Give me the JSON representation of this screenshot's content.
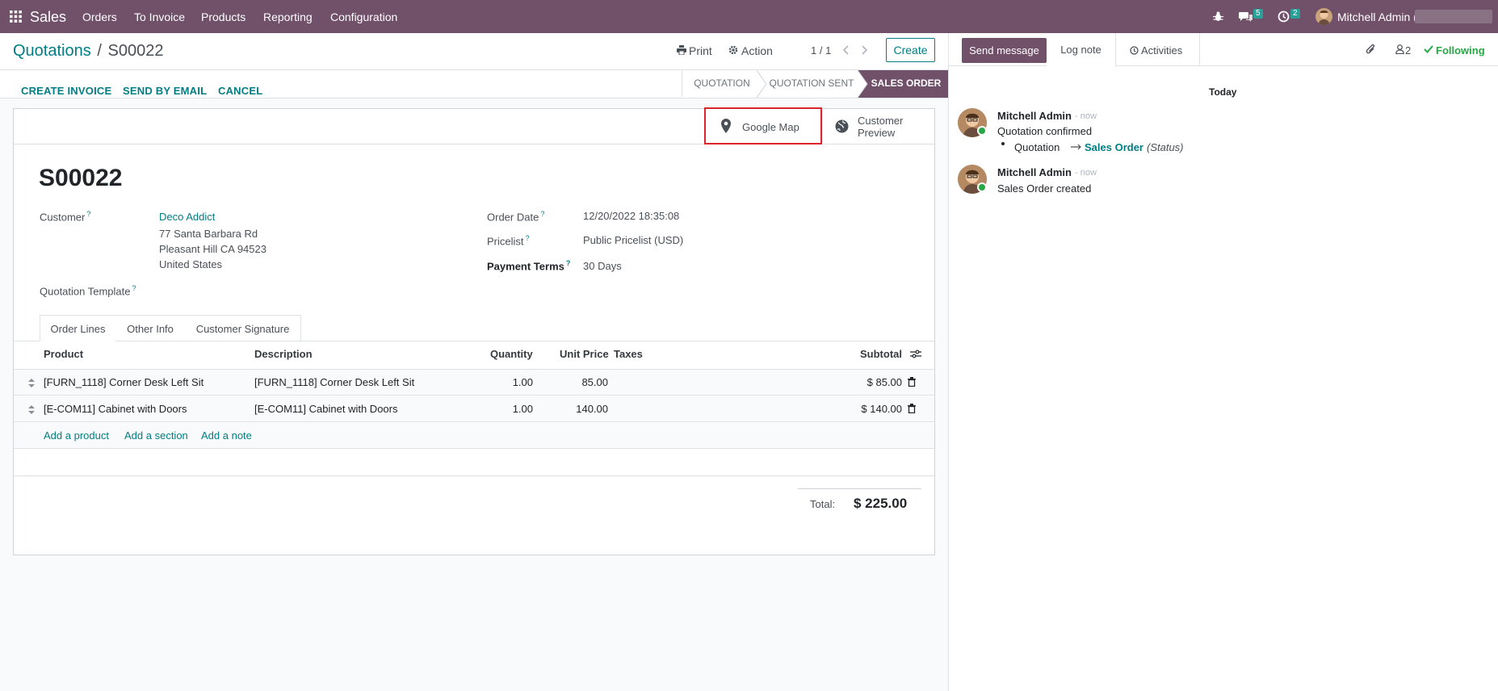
{
  "nav": {
    "app_name": "Sales",
    "menus": [
      "Orders",
      "To Invoice",
      "Products",
      "Reporting",
      "Configuration"
    ],
    "messages_count": "5",
    "activities_count": "2",
    "user_name": "Mitchell Admin ("
  },
  "control_panel": {
    "breadcrumb_parent": "Quotations",
    "breadcrumb_sep": "/",
    "breadcrumb_current": "S00022",
    "print_label": "Print",
    "action_label": "Action",
    "pager": "1 / 1",
    "create_label": "Create"
  },
  "header_actions": {
    "create_invoice": "CREATE INVOICE",
    "send_by_email": "SEND BY EMAIL",
    "cancel": "CANCEL"
  },
  "statusbar": {
    "stages": [
      "QUOTATION",
      "QUOTATION SENT",
      "SALES ORDER"
    ],
    "active_index": 2
  },
  "button_box": {
    "google_map": "Google Map",
    "customer_preview_line1": "Customer",
    "customer_preview_line2": "Preview"
  },
  "form": {
    "title": "S00022",
    "customer_label": "Customer",
    "customer_name": "Deco Addict",
    "customer_address1": "77 Santa Barbara Rd",
    "customer_address2": "Pleasant Hill CA 94523",
    "customer_address3": "United States",
    "quotation_template_label": "Quotation Template",
    "order_date_label": "Order Date",
    "order_date": "12/20/2022 18:35:08",
    "pricelist_label": "Pricelist",
    "pricelist": "Public Pricelist (USD)",
    "payment_terms_label": "Payment Terms",
    "payment_terms": "30 Days",
    "help_mark": "?"
  },
  "tabs": [
    "Order Lines",
    "Other Info",
    "Customer Signature"
  ],
  "order_lines": {
    "columns": {
      "product": "Product",
      "description": "Description",
      "quantity": "Quantity",
      "unit_price": "Unit Price",
      "taxes": "Taxes",
      "subtotal": "Subtotal"
    },
    "rows": [
      {
        "product": "[FURN_1118] Corner Desk Left Sit",
        "description": "[FURN_1118] Corner Desk Left Sit",
        "quantity": "1.00",
        "unit_price": "85.00",
        "taxes": "",
        "subtotal": "$ 85.00"
      },
      {
        "product": "[E-COM11] Cabinet with Doors",
        "description": "[E-COM11] Cabinet with Doors",
        "quantity": "1.00",
        "unit_price": "140.00",
        "taxes": "",
        "subtotal": "$ 140.00"
      }
    ],
    "add_product": "Add a product",
    "add_section": "Add a section",
    "add_note": "Add a note",
    "total_label": "Total:",
    "total_value": "$ 225.00"
  },
  "chatter": {
    "send_message": "Send message",
    "log_note": "Log note",
    "activities": "Activities",
    "followers_count": "2",
    "following": "Following",
    "today": "Today",
    "messages": [
      {
        "author": "Mitchell Admin",
        "time": "- now",
        "body": "Quotation confirmed",
        "tracking_old": "Quotation",
        "tracking_new": "Sales Order",
        "tracking_field": "(Status)"
      },
      {
        "author": "Mitchell Admin",
        "time": "- now",
        "body": "Sales Order created"
      }
    ]
  },
  "colors": {
    "brand": "#71506a",
    "link": "#017e84",
    "highlight_border": "#d9252b"
  }
}
